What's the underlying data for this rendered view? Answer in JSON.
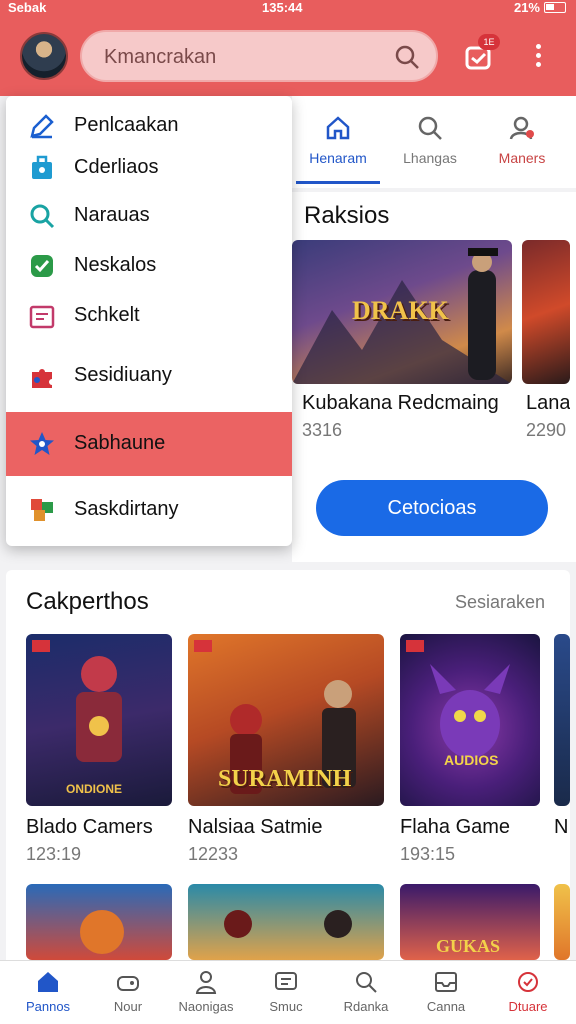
{
  "status_bar": {
    "left": "Sebak",
    "time": "135:44",
    "right": "21%"
  },
  "header": {
    "search_text": "Kmancrakan",
    "notify_badge": "1E"
  },
  "top_tabs": [
    {
      "label": "Henaram",
      "icon": "home-icon"
    },
    {
      "label": "Lhangas",
      "icon": "search-icon"
    },
    {
      "label": "Maners",
      "icon": "user-alert-icon"
    }
  ],
  "dropdown": {
    "items": [
      {
        "label": "Penlcaakan",
        "icon": "edit-icon",
        "color": "#1a5fd0"
      },
      {
        "label": "Cderliaos",
        "icon": "bag-icon",
        "color": "#1f9bd1"
      },
      {
        "label": "Narauas",
        "icon": "search-icon",
        "color": "#19a3a3"
      },
      {
        "label": "Neskalos",
        "icon": "check-icon",
        "color": "#2b9a48"
      },
      {
        "label": "Schkelt",
        "icon": "calendar-icon",
        "color": "#c23a6a"
      },
      {
        "label": "Sesidiuany",
        "icon": "puzzle-icon",
        "color": "#d6333a"
      },
      {
        "label": "Sabhaune",
        "icon": "star-icon",
        "color": "#2156c8"
      },
      {
        "label": "Saskdirtany",
        "icon": "blocks-icon",
        "color": "#e0912c"
      }
    ],
    "active_index": 6
  },
  "top_section": {
    "title": "Raksios",
    "games": [
      {
        "name": "Kubakana Redcmaing",
        "count": "3316",
        "art": "DRAKK"
      },
      {
        "name": "Lana",
        "count": "2290",
        "art": ""
      }
    ],
    "button_label": "Cetocioas"
  },
  "bottom_section": {
    "title": "Cakperthos",
    "see_all": "Sesiaraken",
    "games": [
      {
        "name": "Blado Camers",
        "count": "123:19",
        "art": "ONDIONE"
      },
      {
        "name": "Nalsiaa Satmie",
        "count": "12233",
        "art": "SURAMINH"
      },
      {
        "name": "Flaha Game",
        "count": "193:15",
        "art": "AUDIOS"
      },
      {
        "name": "N",
        "count": "",
        "art": ""
      }
    ],
    "more_art": [
      "",
      "",
      "GUKAS"
    ]
  },
  "bottom_nav": [
    {
      "label": "Pannos",
      "icon": "home-icon"
    },
    {
      "label": "Nour",
      "icon": "gamepad-icon"
    },
    {
      "label": "Naonigas",
      "icon": "person-icon"
    },
    {
      "label": "Smuc",
      "icon": "chat-icon"
    },
    {
      "label": "Rdanka",
      "icon": "search-icon"
    },
    {
      "label": "Canna",
      "icon": "inbox-icon"
    },
    {
      "label": "Dtuare",
      "icon": "alert-icon"
    }
  ],
  "colors": {
    "accent_red": "#e85d5d",
    "primary_blue": "#1a6ae6",
    "active_blue": "#2156c8"
  }
}
